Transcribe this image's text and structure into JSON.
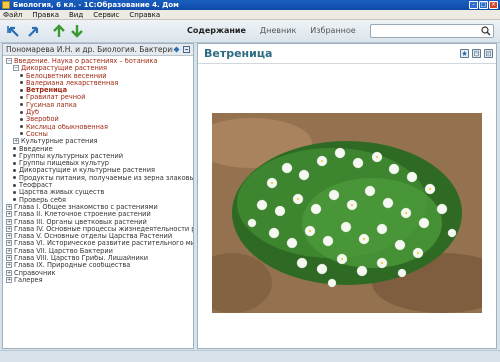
{
  "window": {
    "title": "Биология, 6 кл. - 1С:Образование 4. Дом"
  },
  "menu": [
    "Файл",
    "Правка",
    "Вид",
    "Сервис",
    "Справка"
  ],
  "nav_tabs": [
    {
      "label": "Содержание",
      "active": true
    },
    {
      "label": "Дневник",
      "active": false
    },
    {
      "label": "Избранное",
      "active": false
    }
  ],
  "search": {
    "placeholder": ""
  },
  "book": {
    "title": "Пономарева И.Н. и др. Биология. Бактерии."
  },
  "tree": [
    {
      "label": "Введение. Наука о растениях – ботаника",
      "level": 0,
      "expander": "−",
      "style": "red"
    },
    {
      "label": "Дикорастущие растения",
      "level": 1,
      "expander": "−",
      "style": "red"
    },
    {
      "label": "Белоцветник весенний",
      "level": 2,
      "style": "red"
    },
    {
      "label": "Валериана лекарственная",
      "level": 2,
      "style": "red"
    },
    {
      "label": "Ветреница",
      "level": 2,
      "style": "sel"
    },
    {
      "label": "Гравилат речной",
      "level": 2,
      "style": "red"
    },
    {
      "label": "Гусиная лапка",
      "level": 2,
      "style": "red"
    },
    {
      "label": "Дуб",
      "level": 2,
      "style": "red"
    },
    {
      "label": "Зверобой",
      "level": 2,
      "style": "red"
    },
    {
      "label": "Кислица обыкновенная",
      "level": 2,
      "style": "red"
    },
    {
      "label": "Сосны",
      "level": 2,
      "style": "red"
    },
    {
      "label": "Культурные растения",
      "level": 1,
      "expander": "+",
      "style": ""
    },
    {
      "label": "Введение",
      "level": 1,
      "style": ""
    },
    {
      "label": "Группы культурных растений",
      "level": 1,
      "style": ""
    },
    {
      "label": "Группы пищевых культур",
      "level": 1,
      "style": ""
    },
    {
      "label": "Дикорастущие и культурные растения",
      "level": 1,
      "style": ""
    },
    {
      "label": "Продукты питания, получаемые из зерна злаковых культур",
      "level": 1,
      "style": ""
    },
    {
      "label": "Теофраст",
      "level": 1,
      "style": ""
    },
    {
      "label": "Царства живых существ",
      "level": 1,
      "style": ""
    },
    {
      "label": "Проверь себя",
      "level": 1,
      "style": ""
    },
    {
      "label": "Глава I. Общее знакомство с растениями",
      "level": 0,
      "expander": "+",
      "style": ""
    },
    {
      "label": "Глава II. Клеточное строение растений",
      "level": 0,
      "expander": "+",
      "style": ""
    },
    {
      "label": "Глава III. Органы цветковых растений",
      "level": 0,
      "expander": "+",
      "style": ""
    },
    {
      "label": "Глава IV. Основные процессы жизнедеятельности растений",
      "level": 0,
      "expander": "+",
      "style": ""
    },
    {
      "label": "Глава V. Основные отделы Царства Растений",
      "level": 0,
      "expander": "+",
      "style": ""
    },
    {
      "label": "Глава VI. Историческое развитие растительного мира на Земле",
      "level": 0,
      "expander": "+",
      "style": ""
    },
    {
      "label": "Глава VII. Царство Бактерии",
      "level": 0,
      "expander": "+",
      "style": ""
    },
    {
      "label": "Глава VIII. Царство Грибы. Лишайники",
      "level": 0,
      "expander": "+",
      "style": ""
    },
    {
      "label": "Глава IX. Природные сообщества",
      "level": 0,
      "expander": "+",
      "style": ""
    },
    {
      "label": "Справочник",
      "level": 0,
      "expander": "+",
      "style": ""
    },
    {
      "label": "Галерея",
      "level": 0,
      "expander": "+",
      "style": ""
    }
  ],
  "article": {
    "title": "Ветреница"
  },
  "colors": {
    "title_blue": "#2c6c84",
    "tree_red": "#a02a14",
    "titlebar": "#1a5fbf"
  }
}
